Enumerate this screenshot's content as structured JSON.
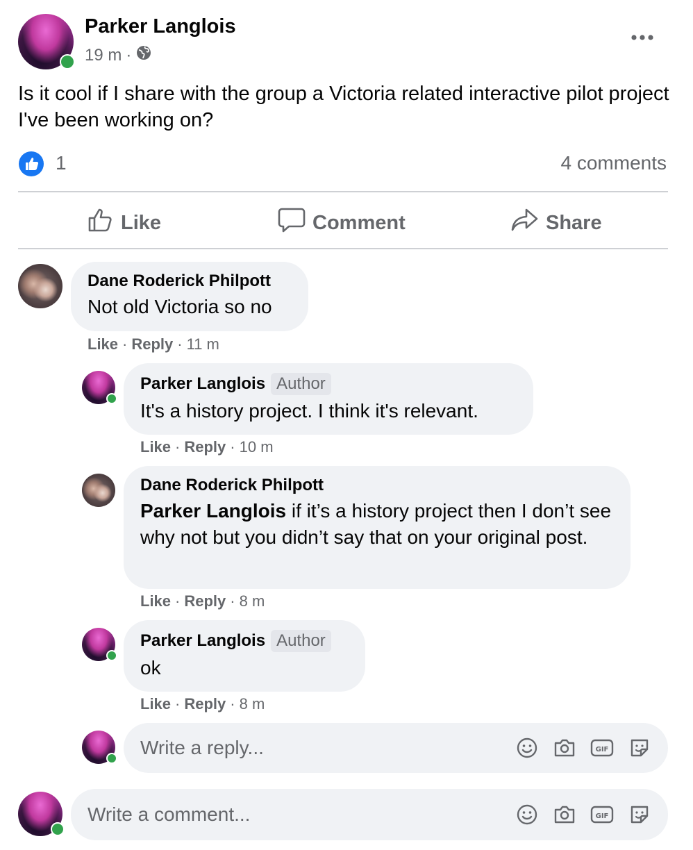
{
  "post": {
    "author": "Parker Langlois",
    "time": "19 m",
    "separator": "·",
    "body": "Is it cool if I share with the group a Victoria related interactive pilot project I've been working on?",
    "like_count": "1",
    "comments_count": "4 comments"
  },
  "actions": {
    "like": "Like",
    "comment": "Comment",
    "share": "Share"
  },
  "comments": [
    {
      "author": "Dane Roderick Philpott",
      "text": "Not old Victoria so no",
      "like": "Like",
      "reply": "Reply",
      "time": "11 m"
    },
    {
      "author": "Parker Langlois",
      "badge": "Author",
      "text": "It's a history project. I think it's relevant.",
      "like": "Like",
      "reply": "Reply",
      "time": "10 m"
    },
    {
      "author": "Dane Roderick Philpott",
      "mention": "Parker Langlois",
      "text": " if it’s a history project then I don’t see why not but you didn’t say that on your original post.",
      "like": "Like",
      "reply": "Reply",
      "time": "8 m"
    },
    {
      "author": "Parker Langlois",
      "badge": "Author",
      "text": "ok",
      "like": "Like",
      "reply": "Reply",
      "time": "8 m"
    }
  ],
  "reply_input": {
    "placeholder": "Write a reply..."
  },
  "comment_input": {
    "placeholder": "Write a comment..."
  },
  "colors": {
    "like_blue": "#1877f2",
    "online_green": "#31a24c",
    "bubble_bg": "#f0f2f5",
    "secondary_text": "#65676b"
  }
}
